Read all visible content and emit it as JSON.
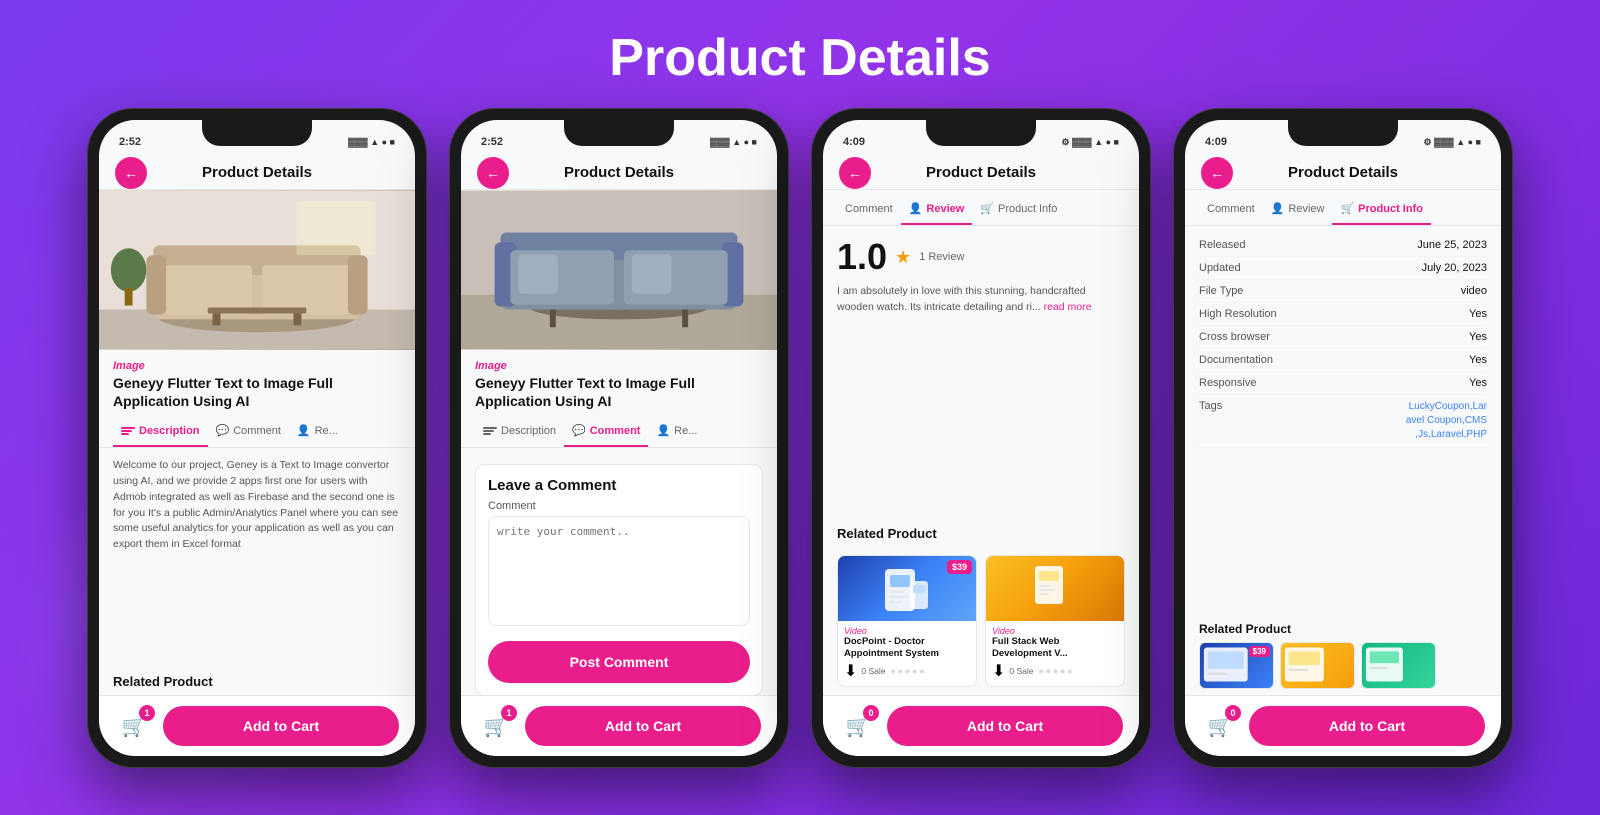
{
  "page": {
    "title": "Product Details"
  },
  "phone1": {
    "status_time": "2:52",
    "status_icons": "🔋",
    "header_title": "Product Details",
    "product_category": "Image",
    "product_name": "Geneyy  Flutter Text to Image Full Application Using AI",
    "tabs": [
      {
        "label": "Description",
        "active": true
      },
      {
        "label": "Comment",
        "active": false
      },
      {
        "label": "Re...",
        "active": false
      }
    ],
    "description": "Welcome to our project, Geney is a Text to Image convertor using AI, and we provide 2 apps first one for users with Admob integrated as well as Firebase and the second one is for you It's a public Admin/Analytics Panel where you can see some useful analytics for your application as well as you can export them in Excel format",
    "related_title": "Related Product",
    "cart_badge": "1",
    "add_to_cart": "Add to Cart"
  },
  "phone2": {
    "status_time": "2:52",
    "header_title": "Product Details",
    "product_category": "Image",
    "product_name": "Geneyy  Flutter Text to Image Full Application Using AI",
    "tabs": [
      {
        "label": "Description",
        "active": false
      },
      {
        "label": "Comment",
        "active": true
      },
      {
        "label": "Re...",
        "active": false
      }
    ],
    "comment_form_title": "Leave a Comment",
    "comment_label": "Comment",
    "comment_placeholder": "write your comment..",
    "post_comment_btn": "Post Comment",
    "cart_badge": "1",
    "add_to_cart": "Add to Cart"
  },
  "phone3": {
    "status_time": "4:09",
    "header_title": "Product Details",
    "tabs": [
      {
        "label": "Comment",
        "active": false
      },
      {
        "label": "Review",
        "active": true
      },
      {
        "label": "Product Info",
        "active": false
      }
    ],
    "rating": "1.0",
    "review_count": "1 Review",
    "review_text": "I am absolutely in love with this stunning, handcrafted wooden watch. Its intricate detailing and ri...",
    "read_more": "read more",
    "related_title": "Related Product",
    "related_products": [
      {
        "type": "Video",
        "title": "DocPoint - Doctor Appointment System",
        "price": "$39",
        "sale_count": "0 Sale"
      },
      {
        "type": "Video",
        "title": "Full Stack Web Development V...",
        "sale_count": "0 Sale"
      }
    ],
    "cart_badge": "0",
    "add_to_cart": "Add to Cart"
  },
  "phone4": {
    "status_time": "4:09",
    "header_title": "Product Details",
    "tabs": [
      {
        "label": "Comment",
        "active": false
      },
      {
        "label": "Review",
        "active": false
      },
      {
        "label": "Product Info",
        "active": true
      }
    ],
    "info_rows": [
      {
        "label": "Released",
        "value": "June 25, 2023"
      },
      {
        "label": "Updated",
        "value": "July 20, 2023"
      },
      {
        "label": "File Type",
        "value": "video"
      },
      {
        "label": "High Resolution",
        "value": "Yes"
      },
      {
        "label": "Cross browser",
        "value": "Yes"
      },
      {
        "label": "Documentation",
        "value": "Yes"
      },
      {
        "label": "Responsive",
        "value": "Yes"
      },
      {
        "label": "Tags",
        "value": "LuckyCoupon,Laravel Coupon,CMS,Js,Laravel,PHP",
        "is_tags": true
      }
    ],
    "related_title": "Related Product",
    "cart_badge": "0",
    "add_to_cart": "Add to Cart"
  }
}
